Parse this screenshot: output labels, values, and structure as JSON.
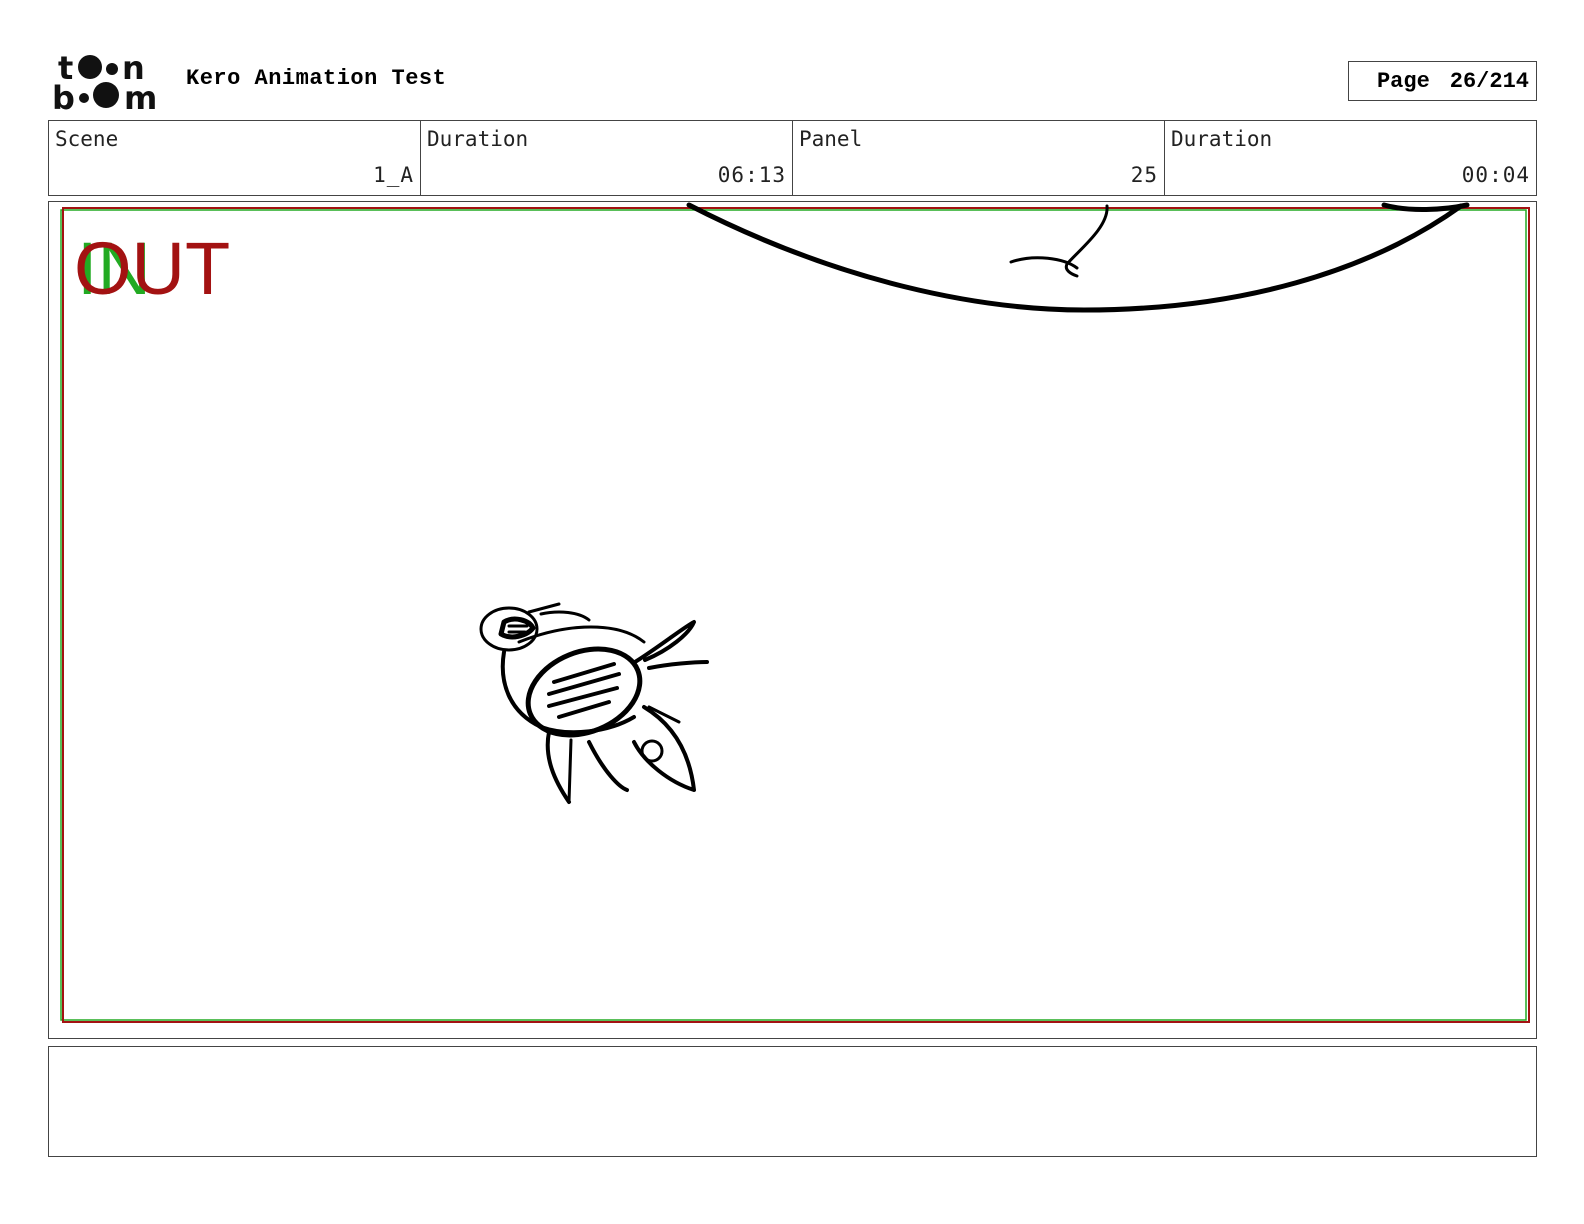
{
  "header": {
    "title": "Kero Animation Test",
    "page_label": "Page",
    "page_value": "26/214"
  },
  "info": {
    "scene_label": "Scene",
    "scene_value": "1_A",
    "scene_duration_label": "Duration",
    "scene_duration_value": "06:13",
    "panel_label": "Panel",
    "panel_value": "25",
    "panel_duration_label": "Duration",
    "panel_duration_value": "00:04"
  },
  "panel": {
    "in_label": "IN",
    "out_label": "OUT",
    "in_color": "#22aa22",
    "out_color": "#a31212"
  },
  "logo": {
    "icon": "toon-boom-logo"
  }
}
